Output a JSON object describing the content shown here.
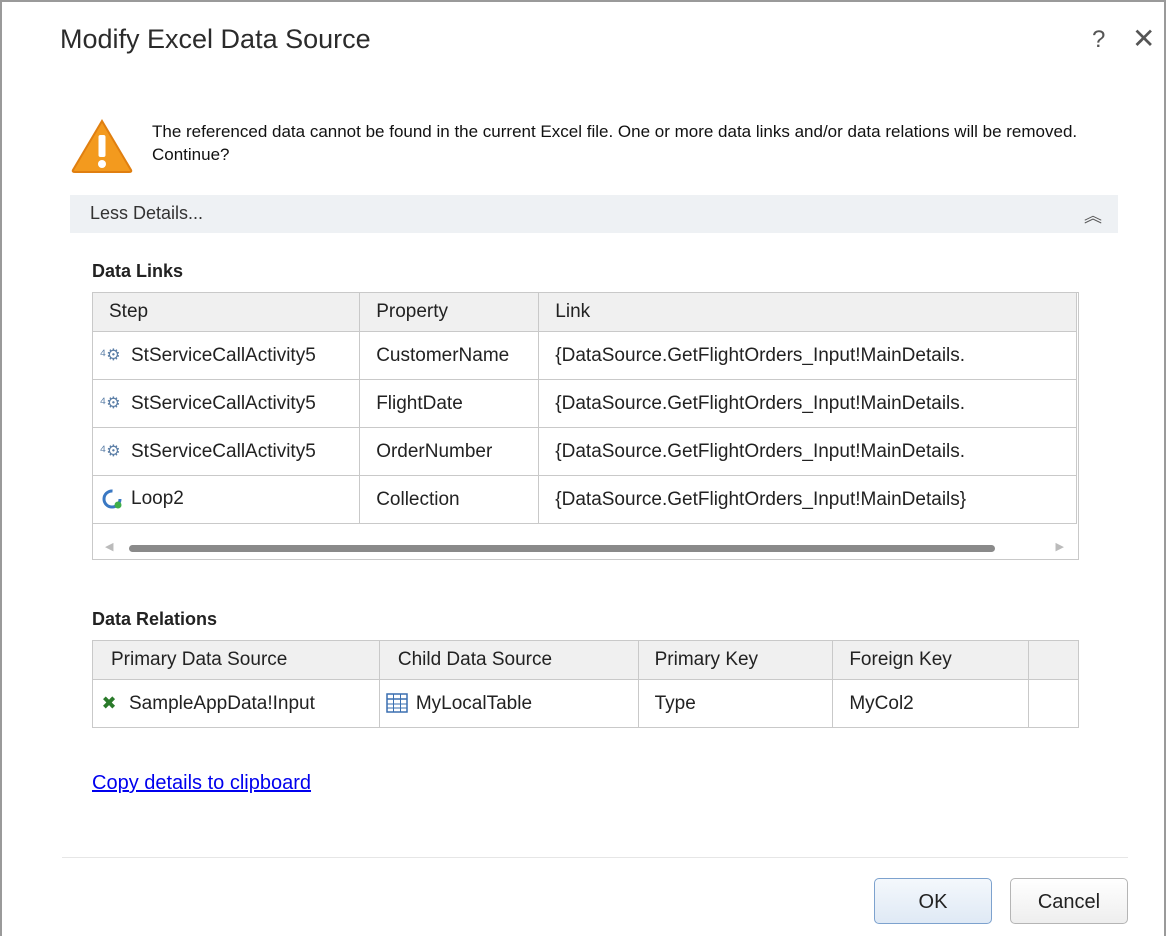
{
  "dialog": {
    "title": "Modify Excel Data Source",
    "help_label": "?",
    "close_label": "✕"
  },
  "message": "The referenced data cannot be found in the current Excel file. One or more data links and/or data relations will be removed. Continue?",
  "less_details": {
    "label": "Less Details...",
    "icon": "double-chevron-up-icon"
  },
  "data_links": {
    "title": "Data Links",
    "columns": [
      "Step",
      "Property",
      "Link"
    ],
    "rows": [
      {
        "step": "StServiceCallActivity5",
        "step_icon": "service-call-icon",
        "property": "CustomerName",
        "link": "{DataSource.GetFlightOrders_Input!MainDetails."
      },
      {
        "step": "StServiceCallActivity5",
        "step_icon": "service-call-icon",
        "property": "FlightDate",
        "link": "{DataSource.GetFlightOrders_Input!MainDetails."
      },
      {
        "step": "StServiceCallActivity5",
        "step_icon": "service-call-icon",
        "property": "OrderNumber",
        "link": "{DataSource.GetFlightOrders_Input!MainDetails."
      },
      {
        "step": "Loop2",
        "step_icon": "loop-icon",
        "property": "Collection",
        "link": "{DataSource.GetFlightOrders_Input!MainDetails}"
      }
    ]
  },
  "data_relations": {
    "title": "Data Relations",
    "columns": [
      "Primary Data Source",
      "Child Data Source",
      "Primary Key",
      "Foreign Key"
    ],
    "rows": [
      {
        "primary": "SampleAppData!Input",
        "primary_icon": "excel-icon",
        "child": "MyLocalTable",
        "child_icon": "table-icon",
        "primary_key": "Type",
        "foreign_key": "MyCol2"
      }
    ]
  },
  "copy_link": "Copy details to clipboard",
  "buttons": {
    "ok": "OK",
    "cancel": "Cancel"
  },
  "colors": {
    "link": "#0000ee",
    "warning": "#f39a1e",
    "excel_green": "#2a7a2a"
  }
}
